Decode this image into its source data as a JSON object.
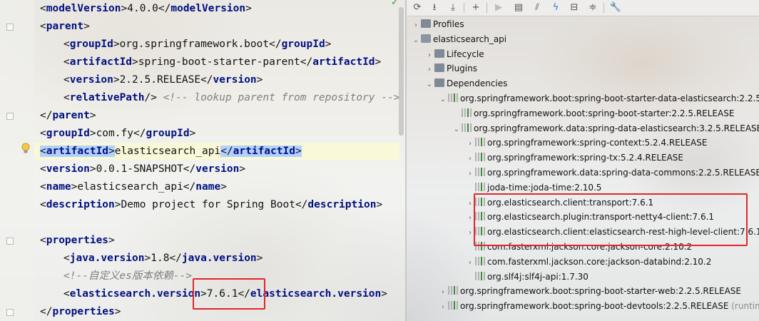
{
  "editor": {
    "lines": [
      {
        "open": "modelVersion",
        "text": "4.0.0",
        "close": "modelVersion"
      },
      {
        "open": "parent"
      },
      {
        "open": "groupId",
        "text": "org.springframework.boot",
        "close": "groupId"
      },
      {
        "open": "artifactId",
        "text": "spring-boot-starter-parent",
        "close": "artifactId"
      },
      {
        "open": "version",
        "text": "2.2.5.RELEASE",
        "close": "version"
      },
      {
        "selfclose": "relativePath",
        "comment": "<!-- lookup parent from repository -->"
      },
      {
        "close_only": "parent"
      },
      {
        "open": "groupId",
        "text": "com.fy",
        "close": "groupId"
      },
      {
        "open": "artifactId",
        "text": "elasticsearch_api",
        "close": "artifactId"
      },
      {
        "open": "version",
        "text": "0.0.1-SNAPSHOT",
        "close": "version"
      },
      {
        "open": "name",
        "text": "elasticsearch_api",
        "close": "name"
      },
      {
        "open": "description",
        "text": "Demo project for Spring Boot",
        "close": "description"
      },
      {},
      {
        "open": "properties"
      },
      {
        "open": "java.version",
        "text": "1.8",
        "close": "java.version"
      },
      {
        "comment": "<!--自定义es版本依赖-->"
      },
      {
        "open": "elasticsearch.version",
        "text": "7.6.1",
        "close": "elasticsearch.version"
      },
      {
        "close_only": "properties"
      }
    ]
  },
  "maven": {
    "toolbar_icons": [
      "refresh-icon",
      "reimport-icon",
      "download-icon",
      "add-icon",
      "run-icon",
      "execute-goal-icon",
      "toggle-offline-icon",
      "skip-tests-icon",
      "show-dependencies-icon",
      "collapse-all-icon",
      "settings-wrench-icon"
    ],
    "tree": [
      {
        "depth": 0,
        "arrow": "collapsed",
        "icon": "folder",
        "label": "Profiles"
      },
      {
        "depth": 0,
        "arrow": "expanded",
        "icon": "maven",
        "label": "elasticsearch_api"
      },
      {
        "depth": 1,
        "arrow": "collapsed",
        "icon": "folder",
        "label": "Lifecycle"
      },
      {
        "depth": 1,
        "arrow": "collapsed",
        "icon": "folder",
        "label": "Plugins"
      },
      {
        "depth": 1,
        "arrow": "expanded",
        "icon": "folder",
        "label": "Dependencies"
      },
      {
        "depth": 2,
        "arrow": "expanded",
        "icon": "lib",
        "label": "org.springframework.boot:spring-boot-starter-data-elasticsearch:2.2.5."
      },
      {
        "depth": 3,
        "arrow": "none",
        "icon": "lib",
        "label": "org.springframework.boot:spring-boot-starter:2.2.5.RELEASE"
      },
      {
        "depth": 3,
        "arrow": "expanded",
        "icon": "lib",
        "label": "org.springframework.data:spring-data-elasticsearch:3.2.5.RELEASE"
      },
      {
        "depth": 4,
        "arrow": "collapsed",
        "icon": "lib",
        "label": "org.springframework:spring-context:5.2.4.RELEASE"
      },
      {
        "depth": 4,
        "arrow": "collapsed",
        "icon": "lib",
        "label": "org.springframework:spring-tx:5.2.4.RELEASE"
      },
      {
        "depth": 4,
        "arrow": "collapsed",
        "icon": "lib",
        "label": "org.springframework.data:spring-data-commons:2.2.5.RELEASE"
      },
      {
        "depth": 4,
        "arrow": "none",
        "icon": "lib",
        "label": "joda-time:joda-time:2.10.5"
      },
      {
        "depth": 4,
        "arrow": "collapsed",
        "icon": "lib",
        "label": "org.elasticsearch.client:transport:7.6.1"
      },
      {
        "depth": 4,
        "arrow": "collapsed",
        "icon": "lib",
        "label": "org.elasticsearch.plugin:transport-netty4-client:7.6.1"
      },
      {
        "depth": 4,
        "arrow": "collapsed",
        "icon": "lib",
        "label": "org.elasticsearch.client:elasticsearch-rest-high-level-client:7.6.1"
      },
      {
        "depth": 4,
        "arrow": "none",
        "icon": "lib",
        "label": "com.fasterxml.jackson.core:jackson-core:2.10.2"
      },
      {
        "depth": 4,
        "arrow": "collapsed",
        "icon": "lib",
        "label": "com.fasterxml.jackson.core:jackson-databind:2.10.2"
      },
      {
        "depth": 4,
        "arrow": "none",
        "icon": "lib",
        "label": "org.slf4j:slf4j-api:1.7.30"
      },
      {
        "depth": 2,
        "arrow": "collapsed",
        "icon": "lib",
        "label": "org.springframework.boot:spring-boot-starter-web:2.2.5.RELEASE"
      },
      {
        "depth": 2,
        "arrow": "collapsed",
        "icon": "lib",
        "label": "org.springframework.boot:spring-boot-devtools:2.2.5.RELEASE",
        "suffix": "(runtime"
      }
    ]
  },
  "colors": {
    "tag": "#001080",
    "comment": "#808080",
    "highlight_box": "#e0282a",
    "selection": "#b3d1ff"
  }
}
